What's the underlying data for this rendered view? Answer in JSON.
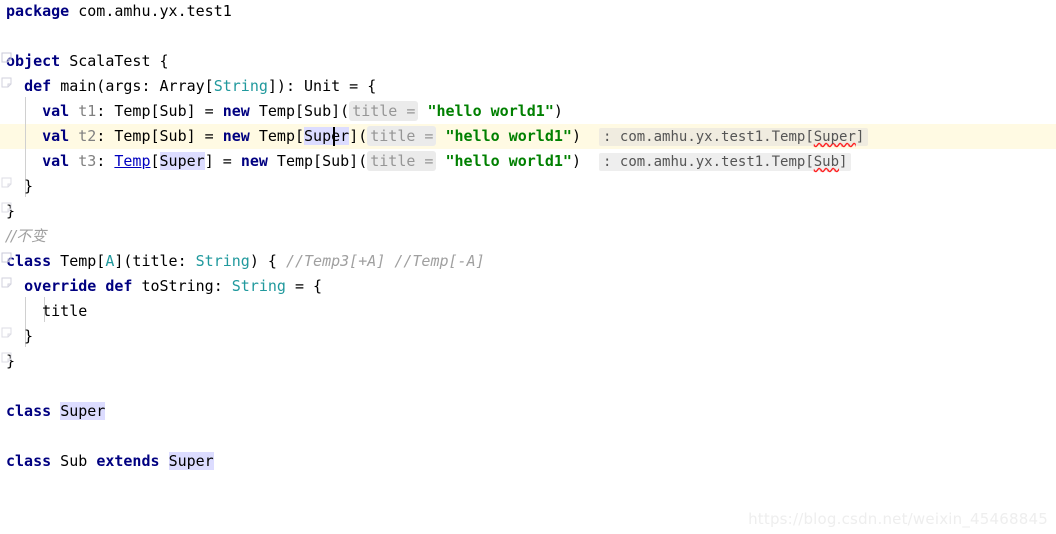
{
  "editor": {
    "language": "Scala",
    "background_color": "#ffffff",
    "current_line_color": "#fffae3",
    "caret_color": "#000000",
    "highlighted_identifier": "Super",
    "identifier_highlight_color": "#dcdcff"
  },
  "code": {
    "line_01": {
      "keyword": "package",
      "package_name": "com.amhu.yx.test1"
    },
    "line_03": {
      "keyword": "object",
      "name": "ScalaTest",
      "brace": "{"
    },
    "line_04": {
      "indent": "  ",
      "keyword": "def",
      "signature": "main(args: ",
      "type_array": "Array[",
      "type_string": "String",
      "tail": "]): Unit = {"
    },
    "line_05": {
      "indent": "    ",
      "keyword": "val",
      "var_name": " t1",
      "decl": ": Temp[Sub] = ",
      "new_kw": "new",
      "ctor": " Temp[Sub](",
      "hint": "title =",
      "string": "\"hello world1\"",
      "close": ")"
    },
    "line_06": {
      "indent": "    ",
      "keyword": "val",
      "var_name": " t2",
      "decl": ": Temp[Sub] = ",
      "new_kw": "new",
      "ctor_pre": " Temp[",
      "ctor_hl": "Super",
      "ctor_post": "](",
      "hint": "title =",
      "string": "\"hello world1\"",
      "close": ")",
      "inlay_prefix": ": com.amhu.yx.test1.Temp[",
      "inlay_error": "Super",
      "inlay_suffix": "]"
    },
    "line_07": {
      "indent": "    ",
      "keyword": "val",
      "var_name": " t3",
      "colon": ": ",
      "link": "Temp",
      "bracket_open": "[",
      "generic_hl": "Super",
      "bracket_close": "]",
      "eq": " = ",
      "new_kw": "new",
      "ctor": " Temp[Sub](",
      "hint": "title =",
      "string": "\"hello world1\"",
      "close": ")",
      "inlay_prefix": ": com.amhu.yx.test1.Temp[",
      "inlay_error": "Sub",
      "inlay_suffix": "]"
    },
    "line_08": {
      "text": "  }"
    },
    "line_09": {
      "text": "}"
    },
    "line_10": {
      "comment": "//不变"
    },
    "line_11": {
      "keyword": "class",
      "name": " Temp[",
      "type_param": "A",
      "params": "](title: ",
      "type_string": "String",
      "brace": ") { ",
      "comment": "//Temp3[+A] //Temp[-A]"
    },
    "line_12": {
      "indent": "  ",
      "keyword": "override def",
      "name": " toString: ",
      "type_string": "String",
      "tail": " = {"
    },
    "line_13": {
      "text": "    title"
    },
    "line_14": {
      "text": "  }"
    },
    "line_15": {
      "text": "}"
    },
    "line_17": {
      "keyword": "class",
      "space": " ",
      "name_hl": "Super"
    },
    "line_19": {
      "keyword": "class",
      "name": " Sub ",
      "extends_kw": "extends",
      "space": " ",
      "super_hl": "Super"
    }
  },
  "watermark": {
    "text": "https://blog.csdn.net/weixin_45468845"
  }
}
